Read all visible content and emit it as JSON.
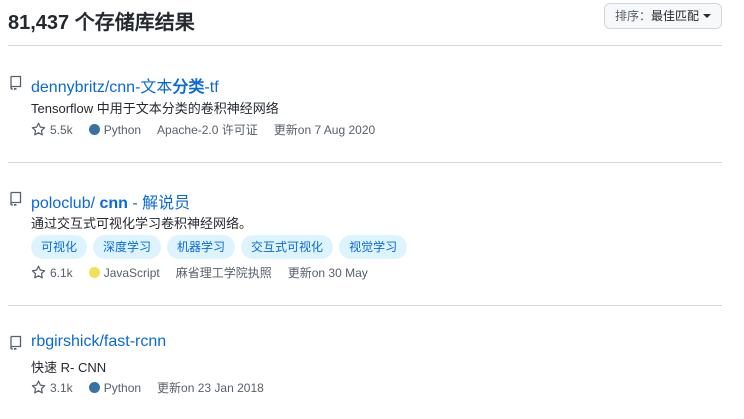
{
  "header": {
    "result_count": "81,437 个存储库结果",
    "sort_label": "排序：",
    "sort_value": "最佳匹配"
  },
  "repos": [
    {
      "title_pre": "dennybritz/cnn-文本",
      "title_hl": "分类",
      "title_post": "-tf",
      "description": "Tensorflow 中用于文本分类的卷积神经网络",
      "stars": "5.5k",
      "language": "Python",
      "language_color": "#3572A5",
      "license": "Apache-2.0 许可证",
      "updated": "更新on 7 Aug 2020"
    },
    {
      "title_pre": "poloclub/ ",
      "title_hl": "cnn",
      "title_post": " - 解说员",
      "description": "通过交互式可视化学习卷积神经网络。",
      "topics": [
        "可视化",
        "深度学习",
        "机器学习",
        "交互式可视化",
        "视觉学习"
      ],
      "stars": "6.1k",
      "language": "JavaScript",
      "language_color": "#f1e05a",
      "owner": "麻省理工学院执照",
      "updated": "更新on 30 May"
    },
    {
      "title_pre": "rbgirshick/fast-rcnn",
      "title_hl": "",
      "title_post": "",
      "description": "快速 R- CNN",
      "stars": "3.1k",
      "language": "Python",
      "language_color": "#3572A5",
      "updated": "更新on 23 Jan 2018"
    }
  ]
}
